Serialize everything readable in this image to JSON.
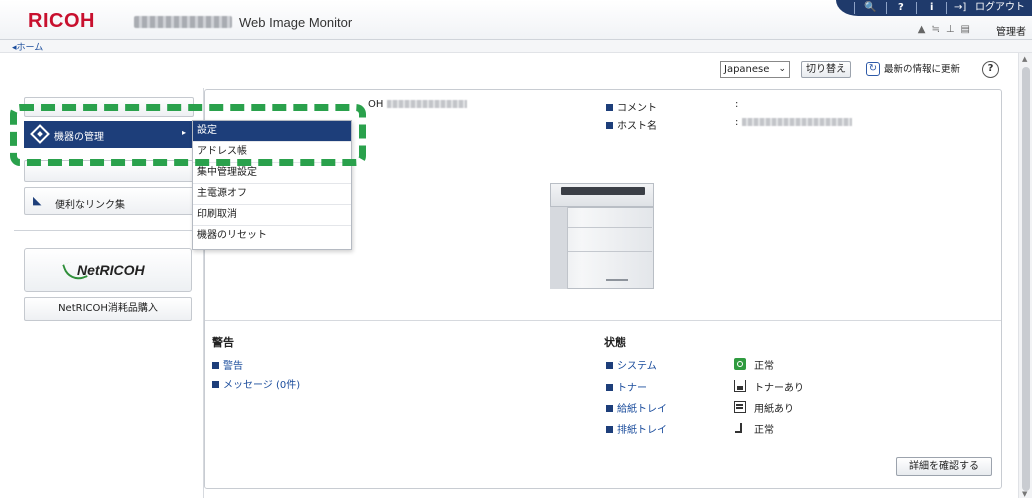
{
  "header": {
    "brand": "RICOH",
    "app_title": "Web Image Monitor",
    "search_icon": "🔍",
    "help_icon": "?",
    "info_icon": "i",
    "logout_label": "ログアウト",
    "admin_label": "管理者"
  },
  "breadcrumb": {
    "home": "ホーム"
  },
  "toolbar": {
    "language": "Japanese",
    "switch_label": "切り替え",
    "refresh_label": "最新の情報に更新",
    "help": "?"
  },
  "sidebar": {
    "active_label": "機器の管理",
    "links_label": "便利なリンク集",
    "netricoh_label": "NetRICOH",
    "buy_label": "NetRICOH消耗品購入"
  },
  "dropdown": {
    "items": [
      "設定",
      "アドレス帳",
      "集中管理設定",
      "主電源オフ",
      "印刷取消",
      "機器のリセット"
    ]
  },
  "device": {
    "model_prefix": "OH",
    "comment_label": "コメント",
    "comment_value": ":",
    "host_label": "ホスト名",
    "host_sep": ":"
  },
  "warnings": {
    "title": "警告",
    "items": [
      "警告",
      "メッセージ (0件)"
    ]
  },
  "status": {
    "title": "状態",
    "rows": [
      {
        "label": "システム",
        "value": "正常"
      },
      {
        "label": "トナー",
        "value": "トナーあり"
      },
      {
        "label": "給紙トレイ",
        "value": "用紙あり"
      },
      {
        "label": "排紙トレイ",
        "value": "正常"
      }
    ]
  },
  "details_button": "詳細を確認する",
  "colors": {
    "brand": "#c8102e",
    "navy": "#1d3e7a",
    "highlight": "#2aa14c",
    "ok_green": "#2f9b3f"
  }
}
